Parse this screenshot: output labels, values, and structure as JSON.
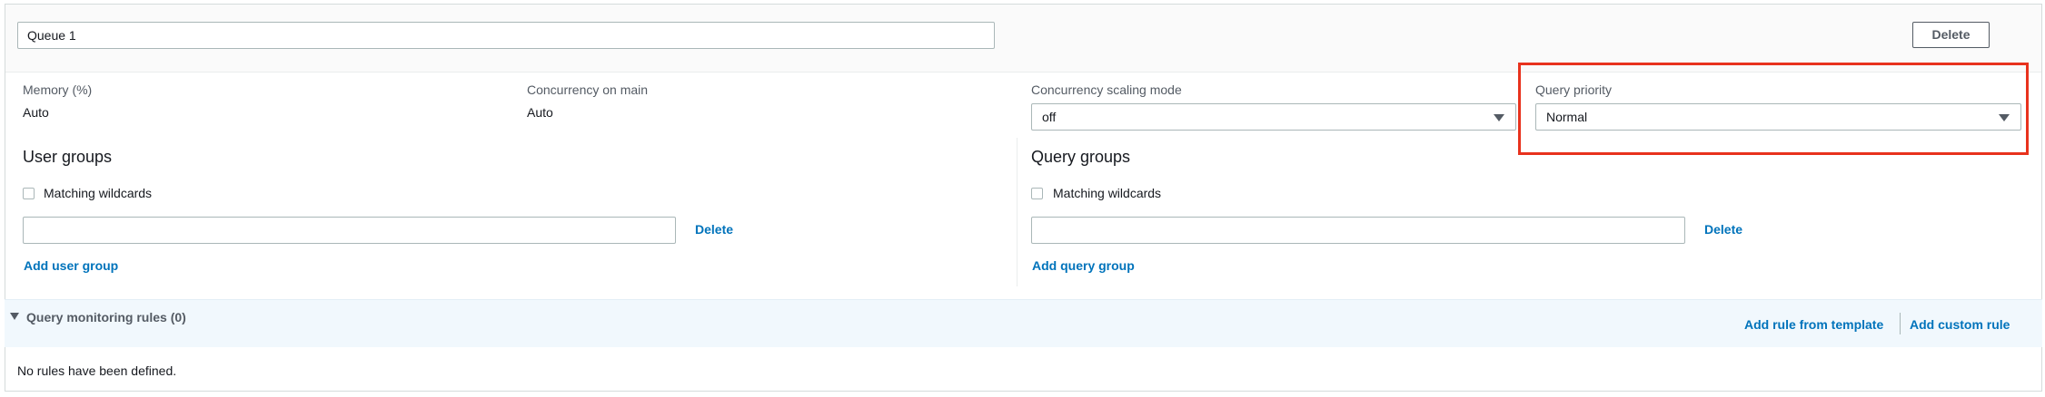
{
  "queue": {
    "name": "Queue 1",
    "delete_label": "Delete"
  },
  "settings": {
    "memory_label": "Memory (%)",
    "memory_value": "Auto",
    "concurrency_label": "Concurrency on main",
    "concurrency_value": "Auto",
    "scaling_label": "Concurrency scaling mode",
    "scaling_value": "off",
    "priority_label": "Query priority",
    "priority_value": "Normal"
  },
  "user_groups": {
    "title": "User groups",
    "wildcards_label": "Matching wildcards",
    "wildcards_checked": false,
    "input_value": "",
    "delete_label": "Delete",
    "add_label": "Add user group"
  },
  "query_groups": {
    "title": "Query groups",
    "wildcards_label": "Matching wildcards",
    "wildcards_checked": false,
    "input_value": "",
    "delete_label": "Delete",
    "add_label": "Add query group"
  },
  "rules": {
    "title": "Query monitoring rules (0)",
    "add_template_label": "Add rule from template",
    "add_custom_label": "Add custom rule",
    "empty_text": "No rules have been defined."
  },
  "colors": {
    "highlight": "#e8321d",
    "link": "#0073bb",
    "rules_band": "#f1f8fd"
  },
  "icons": [
    "dropdown-arrow-icon",
    "expand-caret-icon"
  ]
}
